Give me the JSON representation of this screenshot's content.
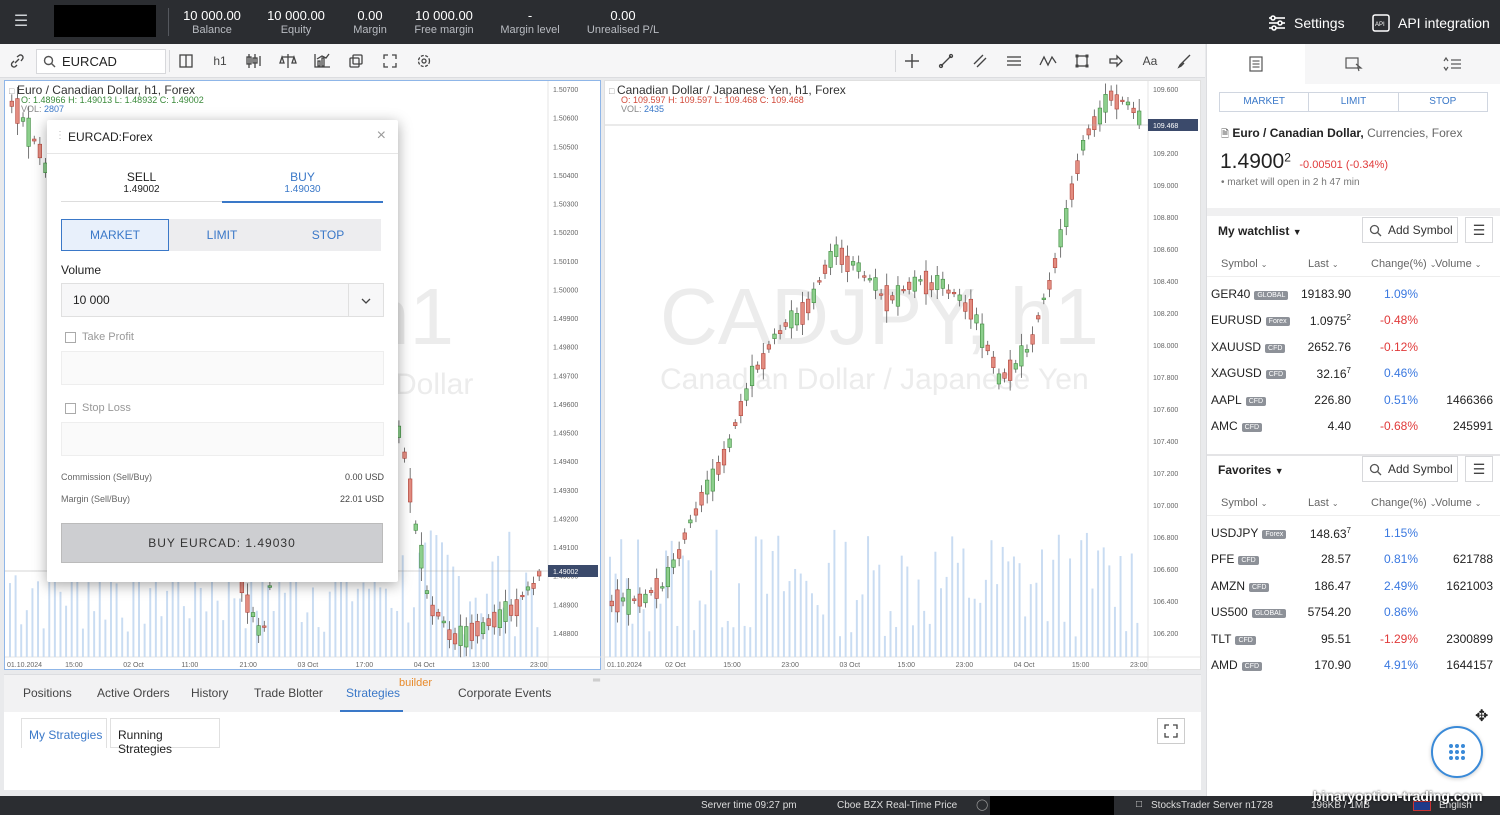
{
  "topbar": {
    "stats": [
      {
        "value": "10 000.00",
        "label": "Balance"
      },
      {
        "value": "10 000.00",
        "label": "Equity"
      },
      {
        "value": "0.00",
        "label": "Margin"
      },
      {
        "value": "10 000.00",
        "label": "Free margin"
      },
      {
        "value": "-",
        "label": "Margin level"
      },
      {
        "value": "0.00",
        "label": "Unrealised P/L"
      }
    ],
    "settings_label": "Settings",
    "api_label": "API integration"
  },
  "toolbar": {
    "symbol": "EURCAD",
    "timeframe": "h1",
    "text_tool": "Aa"
  },
  "chart_left": {
    "title": "Euro / Canadian Dollar,  h1,  Forex",
    "ohlc": {
      "o": "1.48966",
      "h": "1.49013",
      "l": "1.48932",
      "c": "1.49002"
    },
    "vol": "2807",
    "watermark_big": "h1",
    "watermark_small": "Dollar",
    "price_axis": [
      "1.50700",
      "1.50600",
      "1.50500",
      "1.50400",
      "1.50300",
      "1.50200",
      "1.50100",
      "1.50000",
      "1.49900",
      "1.49800",
      "1.49700",
      "1.49600",
      "1.49500",
      "1.49400",
      "1.49300",
      "1.49200",
      "1.49100",
      "1.49000",
      "1.48900",
      "1.48800"
    ],
    "current_price": "1.49002",
    "time_axis": [
      "01.10.2024",
      "15:00",
      "02 Oct",
      "11:00",
      "21:00",
      "03 Oct",
      "17:00",
      "04 Oct",
      "13:00",
      "23:00"
    ]
  },
  "chart_right": {
    "title": "Canadian Dollar / Japanese Yen,  h1,  Forex",
    "ohlc": {
      "o": "109.597",
      "h": "109.597",
      "l": "109.468",
      "c": "109.468"
    },
    "vol": "2435",
    "watermark_big": "CADJPY, h1",
    "watermark_small": "Canadian Dollar / Japanese Yen",
    "price_axis": [
      "109.600",
      "109.400",
      "109.200",
      "109.000",
      "108.800",
      "108.600",
      "108.400",
      "108.200",
      "108.000",
      "107.800",
      "107.600",
      "107.400",
      "107.200",
      "107.000",
      "106.800",
      "106.600",
      "106.400",
      "106.200"
    ],
    "current_price": "109.468",
    "time_axis": [
      "01.10.2024",
      "02 Oct",
      "15:00",
      "23:00",
      "03 Oct",
      "15:00",
      "23:00",
      "04 Oct",
      "15:00",
      "23:00"
    ]
  },
  "order_dialog": {
    "title": "EURCAD:Forex",
    "sell_label": "SELL",
    "sell_price": "1.49002",
    "buy_label": "BUY",
    "buy_price": "1.49030",
    "order_types": [
      "MARKET",
      "LIMIT",
      "STOP"
    ],
    "volume_label": "Volume",
    "volume_value": "10 000",
    "take_profit_label": "Take Profit",
    "stop_loss_label": "Stop Loss",
    "commission_label": "Commission (Sell/Buy)",
    "commission_value": "0.00 USD",
    "margin_label": "Margin (Sell/Buy)",
    "margin_value": "22.01 USD",
    "submit_label": "BUY EURCAD: 1.49030"
  },
  "bottom": {
    "tabs": [
      "Positions",
      "Active Orders",
      "History",
      "Trade Blotter",
      "Strategies",
      "Corporate Events"
    ],
    "builder_badge": "builder",
    "subtabs": [
      "My Strategies",
      "Running Strategies"
    ]
  },
  "right_panel": {
    "order_types": [
      "MARKET",
      "LIMIT",
      "STOP"
    ],
    "instrument_name": "Euro / Canadian Dollar,",
    "instrument_meta": " Currencies, Forex",
    "price_main": "1.4900",
    "price_sup": "2",
    "price_change": "-0.00501 (-0.34%)",
    "market_note": "market will open in 2 h 47 min",
    "watchlist_title": "My watchlist",
    "favorites_title": "Favorites",
    "add_symbol": "Add Symbol",
    "columns": [
      "Symbol",
      "Last",
      "Change(%)",
      "Volume"
    ],
    "watchlist": [
      {
        "sym": "GER40",
        "tag": "GLOBAL",
        "last": "19183.90",
        "chg": "1.09%",
        "dir": "pos",
        "vol": ""
      },
      {
        "sym": "EURUSD",
        "tag": "Forex",
        "last": "1.0975",
        "sup": "2",
        "chg": "-0.48%",
        "dir": "neg",
        "vol": ""
      },
      {
        "sym": "XAUUSD",
        "tag": "CFD",
        "last": "2652.76",
        "chg": "-0.12%",
        "dir": "neg",
        "vol": ""
      },
      {
        "sym": "XAGUSD",
        "tag": "CFD",
        "last": "32.16",
        "sup": "7",
        "chg": "0.46%",
        "dir": "pos",
        "vol": ""
      },
      {
        "sym": "AAPL",
        "tag": "CFD",
        "last": "226.80",
        "chg": "0.51%",
        "dir": "pos",
        "vol": "1466366"
      },
      {
        "sym": "AMC",
        "tag": "CFD",
        "last": "4.40",
        "chg": "-0.68%",
        "dir": "neg",
        "vol": "245991"
      }
    ],
    "favorites": [
      {
        "sym": "USDJPY",
        "tag": "Forex",
        "last": "148.63",
        "sup": "7",
        "chg": "1.15%",
        "dir": "pos",
        "vol": ""
      },
      {
        "sym": "PFE",
        "tag": "CFD",
        "last": "28.57",
        "chg": "0.81%",
        "dir": "pos",
        "vol": "621788"
      },
      {
        "sym": "AMZN",
        "tag": "CFD",
        "last": "186.47",
        "chg": "2.49%",
        "dir": "pos",
        "vol": "1621003"
      },
      {
        "sym": "US500",
        "tag": "GLOBAL",
        "last": "5754.20",
        "chg": "0.86%",
        "dir": "pos",
        "vol": ""
      },
      {
        "sym": "TLT",
        "tag": "CFD",
        "last": "95.51",
        "chg": "-1.29%",
        "dir": "neg",
        "vol": "2300899"
      },
      {
        "sym": "AMD",
        "tag": "CFD",
        "last": "170.90",
        "chg": "4.91%",
        "dir": "pos",
        "vol": "1644157"
      }
    ]
  },
  "statusbar": {
    "server_time": "Server time 09:27 pm",
    "price_source": "Cboe BZX Real-Time Price",
    "server_name": "StocksTrader Server n1728",
    "traffic": "196KB / 1MB",
    "language": "English",
    "watermark": "binaryoption-trading.com"
  }
}
